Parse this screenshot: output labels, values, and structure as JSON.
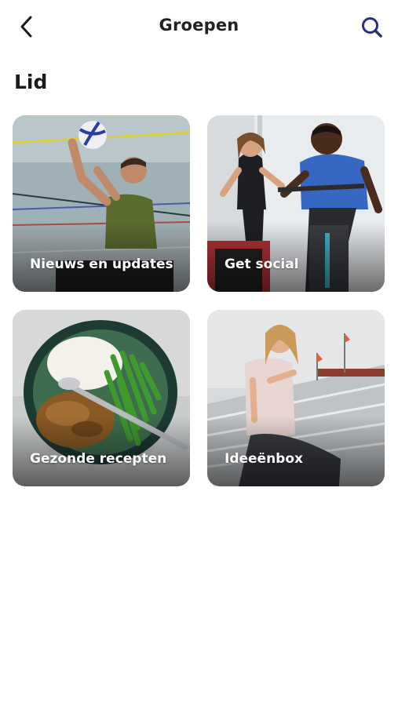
{
  "header": {
    "title": "Groepen",
    "back_icon": "chevron-left-icon",
    "search_icon": "search-icon",
    "accent_color": "#2c2f7a"
  },
  "section": {
    "title": "Lid"
  },
  "groups": [
    {
      "label": "Nieuws en updates",
      "image": "volleyball-player-photo"
    },
    {
      "label": "Get social",
      "image": "spinning-class-photo"
    },
    {
      "label": "Gezonde recepten",
      "image": "healthy-food-bowl-photo"
    },
    {
      "label": "Ideeënbox",
      "image": "woman-in-stadium-photo"
    }
  ]
}
